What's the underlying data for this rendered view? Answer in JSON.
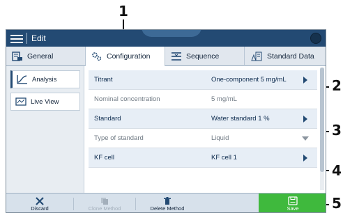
{
  "callouts": [
    "1",
    "2",
    "3",
    "4",
    "5"
  ],
  "titlebar": {
    "title": "Edit",
    "menu_icon": "hamburger-icon",
    "status_icon": "status-indicator-icon"
  },
  "tabs": [
    {
      "label": "General",
      "icon": "general-icon"
    },
    {
      "label": "Configuration",
      "icon": "gears-icon",
      "active": true
    },
    {
      "label": "Sequence",
      "icon": "sequence-icon"
    },
    {
      "label": "Standard Data",
      "icon": "standard-data-icon"
    }
  ],
  "sidenav": [
    {
      "label": "Analysis",
      "icon": "analysis-icon",
      "active": true
    },
    {
      "label": "Live View",
      "icon": "live-view-icon"
    }
  ],
  "rows": [
    {
      "label": "Titrant",
      "value": "One-component 5 mg/mL",
      "editable": true
    },
    {
      "label": "Nominal concentration",
      "value": "5 mg/mL",
      "editable": false
    },
    {
      "label": "Standard",
      "value": "Water standard 1 %",
      "editable": true
    },
    {
      "label": "Type of standard",
      "value": "Liquid",
      "editable": false
    },
    {
      "label": "KF cell",
      "value": "KF cell 1",
      "editable": true
    }
  ],
  "footer": {
    "discard": "Discard",
    "clone": "Clone Method",
    "delete": "Delete Method",
    "save": "Save"
  },
  "colors": {
    "header": "#234a73",
    "save": "#3fb93d",
    "editable_row": "#e7eef6"
  }
}
